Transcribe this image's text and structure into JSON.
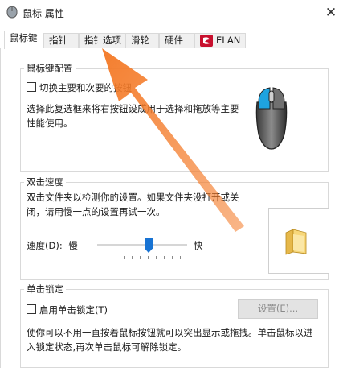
{
  "window": {
    "title": "鼠标 属性",
    "close_glyph": "✕"
  },
  "tabs": [
    {
      "label": "鼠标键",
      "active": true
    },
    {
      "label": "指针",
      "active": false
    },
    {
      "label": "指针选项",
      "active": false
    },
    {
      "label": "滑轮",
      "active": false
    },
    {
      "label": "硬件",
      "active": false
    },
    {
      "label": "ELAN",
      "active": false,
      "icon": "elan-logo-icon"
    }
  ],
  "button_config": {
    "legend": "鼠标键配置",
    "switch_checkbox_label": "切换主要和次要的按钮",
    "switch_checked": false,
    "description_line1": "选择此复选框来将右按钮设成用于选择和拖放等主要",
    "description_line2": "性能使用。",
    "icon": "mouse-icon"
  },
  "double_click": {
    "legend": "双击速度",
    "description_line1": "双击文件夹以检测你的设置。如果文件夹没打开或关",
    "description_line2": "闭，请用慢一点的设置再试一次。",
    "speed_label": "速度(D):",
    "slow_label": "慢",
    "fast_label": "快",
    "speed_fraction": 0.55,
    "test_icon": "folder-icon"
  },
  "click_lock": {
    "legend": "单击锁定",
    "checkbox_label": "启用单击锁定(T)",
    "checked": false,
    "settings_button": "设置(E)...",
    "settings_enabled": false,
    "description_line1": "使你可以不用一直按着鼠标按钮就可以突出显示或拖拽。单击鼠标以进",
    "description_line2": "入锁定状态,再次单击鼠标可解除锁定。"
  },
  "colors": {
    "accent": "#1873d3",
    "arrow": "#f47b29"
  }
}
